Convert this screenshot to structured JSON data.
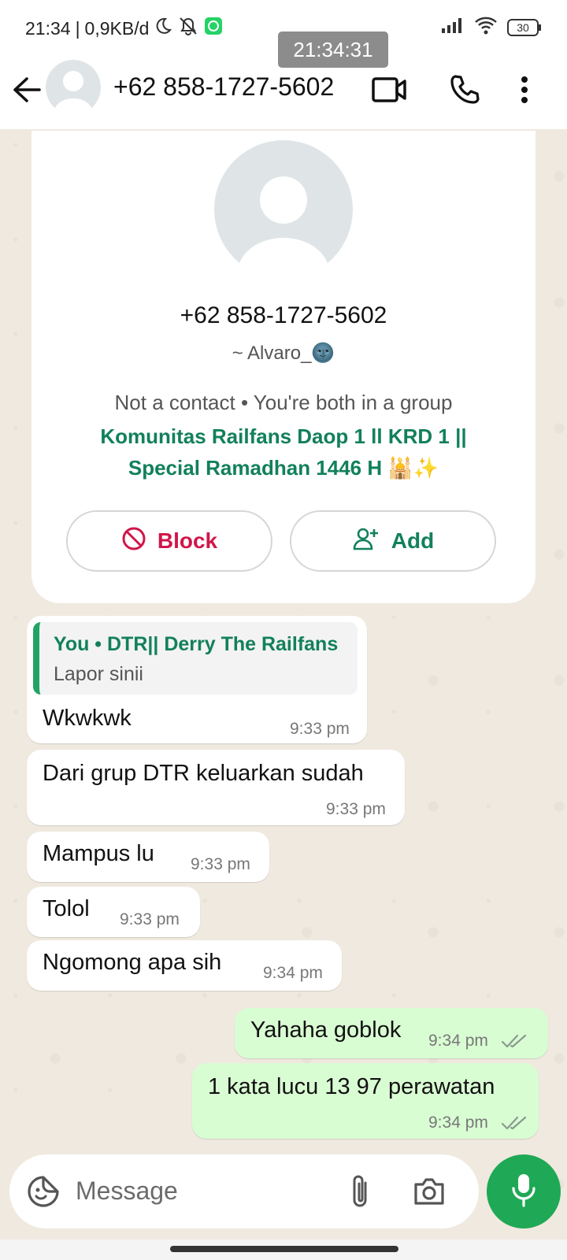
{
  "status_bar": {
    "time": "21:34",
    "network": "0,9KB/d",
    "battery": "30",
    "icons": [
      "moon-icon",
      "notifications-off-icon",
      "whatsapp-icon",
      "signal-icon",
      "wifi-icon",
      "battery-icon"
    ]
  },
  "timestamp_overlay": "21:34:31",
  "header": {
    "title": "+62 858-1727-5602",
    "icons": [
      "back-arrow-icon",
      "video-call-icon",
      "voice-call-icon",
      "more-vert-icon"
    ]
  },
  "profile_card": {
    "phone": "+62 858-1727-5602",
    "name": "~ Alvaro_🌚",
    "context": "Not a contact • You're both in a group",
    "group_name": "Komunitas Railfans Daop 1 ll KRD 1 || Special Ramadhan 1446 H 🕌✨",
    "block_label": "Block",
    "add_label": "Add"
  },
  "messages": [
    {
      "direction": "in",
      "quote_title": "You • DTR|| Derry The Railfans",
      "quote_text": "Lapor sinii",
      "text": "Wkwkwk",
      "time": "9:33 pm"
    },
    {
      "direction": "in",
      "text": "Dari grup DTR keluarkan sudah",
      "time": "9:33 pm"
    },
    {
      "direction": "in",
      "text": "Mampus lu",
      "time": "9:33 pm"
    },
    {
      "direction": "in",
      "text": "Tolol",
      "time": "9:33 pm"
    },
    {
      "direction": "in",
      "text": "Ngomong apa sih",
      "time": "9:34 pm"
    },
    {
      "direction": "out",
      "text": "Yahaha goblok",
      "time": "9:34 pm",
      "status": "read"
    },
    {
      "direction": "out",
      "text": "1 kata lucu 13 97 perawatan",
      "time": "9:34 pm",
      "status": "read"
    }
  ],
  "composer": {
    "placeholder": "Message",
    "icons": [
      "sticker-icon",
      "attach-icon",
      "camera-icon",
      "mic-icon"
    ]
  },
  "colors": {
    "accent": "#1fa855",
    "group_link": "#12805c",
    "block": "#d0164a",
    "outgoing_bubble": "#d9fdd3",
    "chat_background": "#efe9df"
  }
}
